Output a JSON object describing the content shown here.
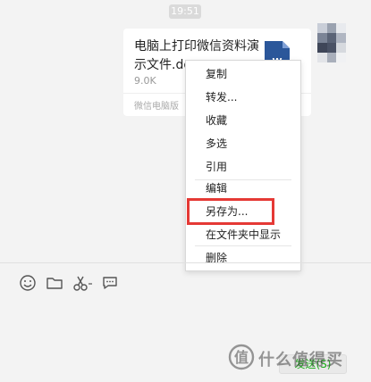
{
  "timestamp": "19:51",
  "message": {
    "file_name": "电脑上打印微信资料演示文件.doc",
    "file_size": "9.0K",
    "source": "微信电脑版",
    "file_icon": "word-doc-icon"
  },
  "context_menu": {
    "items": [
      {
        "label": "复制"
      },
      {
        "label": "转发..."
      },
      {
        "label": "收藏"
      },
      {
        "label": "多选"
      },
      {
        "label": "引用"
      },
      {
        "label": "编辑"
      },
      {
        "label": "另存为..."
      },
      {
        "label": "在文件夹中显示"
      },
      {
        "label": "删除"
      }
    ],
    "highlight_color": "#e53935"
  },
  "toolbar": {
    "icons": [
      "emoji-icon",
      "folder-icon",
      "scissors-icon",
      "chat-bubble-icon"
    ]
  },
  "send_button": {
    "label": "发送(S)"
  },
  "watermark": {
    "text": "什么值得买"
  }
}
